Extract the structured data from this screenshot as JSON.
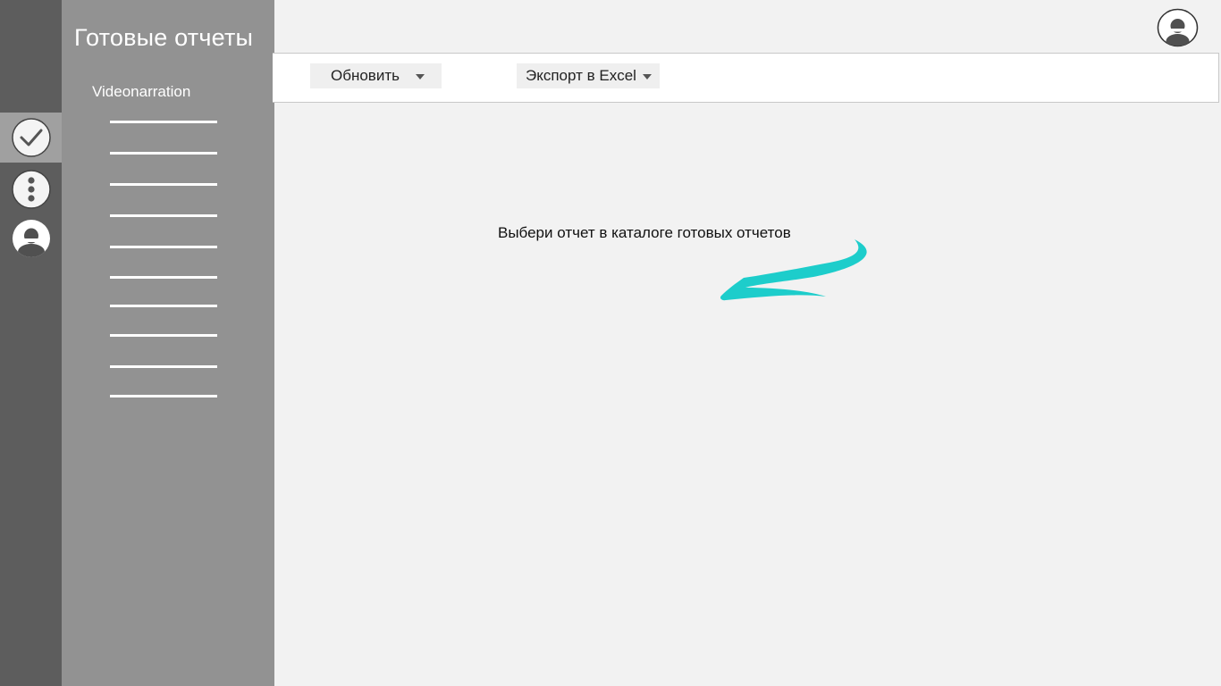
{
  "sidebar": {
    "title": "Готовые отчеты",
    "group_label": "Videonarration",
    "report_count": 10
  },
  "rail": {
    "items": [
      {
        "icon": "check-circle-icon",
        "active": true
      },
      {
        "icon": "more-vertical-icon",
        "active": false
      },
      {
        "icon": "user-circle-icon",
        "active": false
      }
    ]
  },
  "header": {
    "avatar_icon": "user-circle-icon"
  },
  "toolbar": {
    "refresh_label": "Обновить",
    "export_label": "Экспорт в Excel"
  },
  "main": {
    "hint": "Выбери отчет в каталоге готовых отчетов"
  },
  "colors": {
    "rail_bg": "#5d5d5d",
    "rail_active": "#a0a0a0",
    "sidebar_bg": "#929292",
    "content_bg": "#f2f2f2",
    "accent_arrow": "#1dcdcb"
  }
}
